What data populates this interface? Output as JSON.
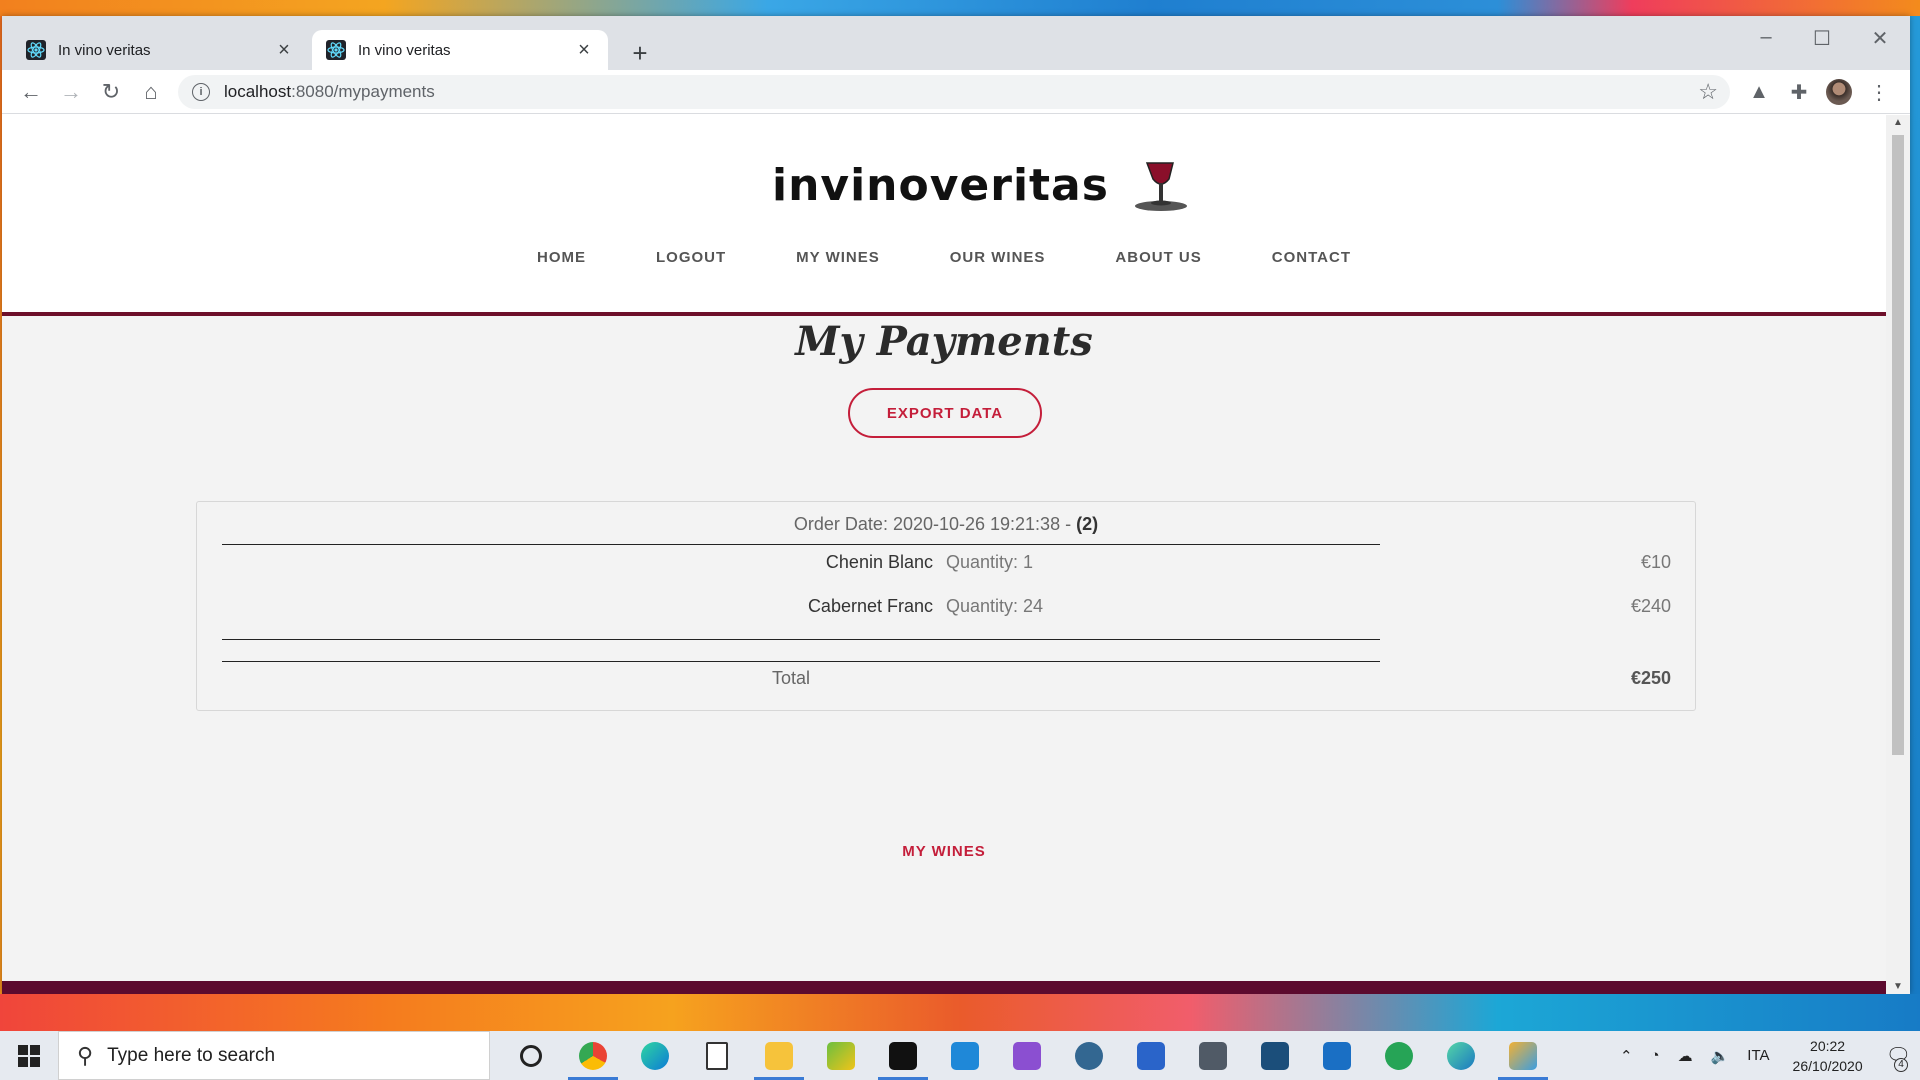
{
  "browser": {
    "tabs": [
      {
        "title": "In vino veritas",
        "active": false
      },
      {
        "title": "In vino veritas",
        "active": true
      }
    ],
    "url_host": "localhost",
    "url_path": ":8080/mypayments"
  },
  "site": {
    "logo_text": "invinoveritas",
    "nav": [
      "HOME",
      "LOGOUT",
      "MY WINES",
      "OUR WINES",
      "ABOUT US",
      "CONTACT"
    ],
    "page_title": "My Payments",
    "export_label": "EXPORT DATA",
    "order": {
      "date_prefix": "Order Date: 2020-10-26 19:21:38 - ",
      "count": "(2)",
      "items": [
        {
          "name": "Chenin Blanc",
          "quantity": "Quantity: 1",
          "price": "€10"
        },
        {
          "name": "Cabernet Franc",
          "quantity": "Quantity: 24",
          "price": "€240"
        }
      ],
      "total_label": "Total",
      "total_value": "€250"
    },
    "footer_link": "MY WINES"
  },
  "taskbar": {
    "search_placeholder": "Type here to search",
    "language": "ITA",
    "time": "20:22",
    "date": "26/10/2020",
    "notification_count": "4"
  },
  "colors": {
    "accent": "#c41e3a",
    "brand_dark": "#6d0f2a",
    "footer": "#5c0a2e"
  }
}
